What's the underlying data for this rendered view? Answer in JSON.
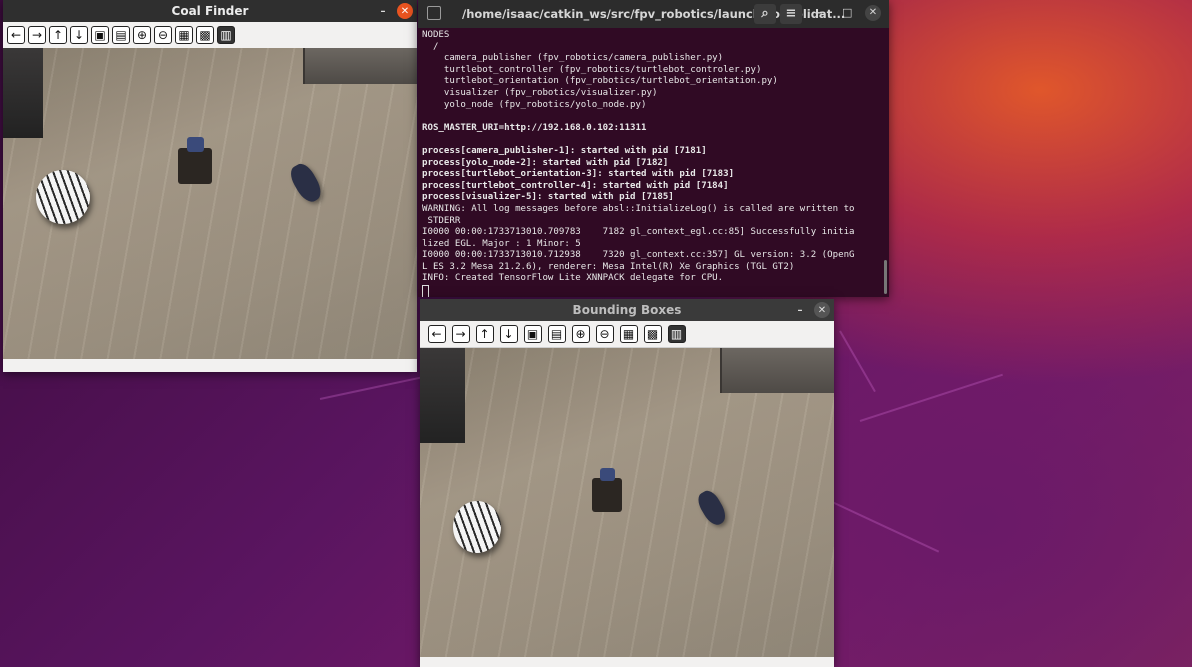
{
  "coal_finder": {
    "title": "Coal Finder",
    "minimize_glyph": "–",
    "close_glyph": "✕",
    "toolbar_icons": [
      "arrow-left-icon",
      "arrow-right-icon",
      "arrow-up-icon",
      "arrow-down-icon",
      "fit-icon",
      "fit-alt-icon",
      "zoom-in-icon",
      "zoom-out-icon",
      "save-icon",
      "save-alt-icon",
      "properties-icon"
    ],
    "toolbar_glyphs": [
      "←",
      "→",
      "↑",
      "↓",
      "▣",
      "▤",
      "⊕",
      "⊖",
      "▦",
      "▩",
      "▥"
    ]
  },
  "terminal": {
    "title": "/home/isaac/catkin_ws/src/fpv_robotics/launch/consolidat...",
    "search_glyph": "⌕",
    "menu_glyph": "≡",
    "minimize_glyph": "–",
    "maximize_glyph": "□",
    "close_glyph": "✕",
    "lines": [
      {
        "text": "NODES",
        "bold": false
      },
      {
        "text": "  /",
        "bold": false
      },
      {
        "text": "    camera_publisher (fpv_robotics/camera_publisher.py)",
        "bold": false
      },
      {
        "text": "    turtlebot_controller (fpv_robotics/turtlebot_controler.py)",
        "bold": false
      },
      {
        "text": "    turtlebot_orientation (fpv_robotics/turtlebot_orientation.py)",
        "bold": false
      },
      {
        "text": "    visualizer (fpv_robotics/visualizer.py)",
        "bold": false
      },
      {
        "text": "    yolo_node (fpv_robotics/yolo_node.py)",
        "bold": false
      },
      {
        "text": "",
        "bold": false
      },
      {
        "text": "ROS_MASTER_URI=http://192.168.0.102:11311",
        "bold": true
      },
      {
        "text": "",
        "bold": false
      },
      {
        "text": "process[camera_publisher-1]: started with pid [7181]",
        "bold": true
      },
      {
        "text": "process[yolo_node-2]: started with pid [7182]",
        "bold": true
      },
      {
        "text": "process[turtlebot_orientation-3]: started with pid [7183]",
        "bold": true
      },
      {
        "text": "process[turtlebot_controller-4]: started with pid [7184]",
        "bold": true
      },
      {
        "text": "process[visualizer-5]: started with pid [7185]",
        "bold": true
      },
      {
        "text": "WARNING: All log messages before absl::InitializeLog() is called are written to",
        "bold": false
      },
      {
        "text": " STDERR",
        "bold": false
      },
      {
        "text": "I0000 00:00:1733713010.709783    7182 gl_context_egl.cc:85] Successfully initia",
        "bold": false
      },
      {
        "text": "lized EGL. Major : 1 Minor: 5",
        "bold": false
      },
      {
        "text": "I0000 00:00:1733713010.712938    7320 gl_context.cc:357] GL version: 3.2 (OpenG",
        "bold": false
      },
      {
        "text": "L ES 3.2 Mesa 21.2.6), renderer: Mesa Intel(R) Xe Graphics (TGL GT2)",
        "bold": false
      },
      {
        "text": "INFO: Created TensorFlow Lite XNNPACK delegate for CPU.",
        "bold": false
      }
    ]
  },
  "bounding_boxes": {
    "title": "Bounding Boxes",
    "minimize_glyph": "–",
    "close_glyph": "✕",
    "toolbar_glyphs": [
      "←",
      "→",
      "↑",
      "↓",
      "▣",
      "▤",
      "⊕",
      "⊖",
      "▦",
      "▩",
      "▥"
    ]
  }
}
